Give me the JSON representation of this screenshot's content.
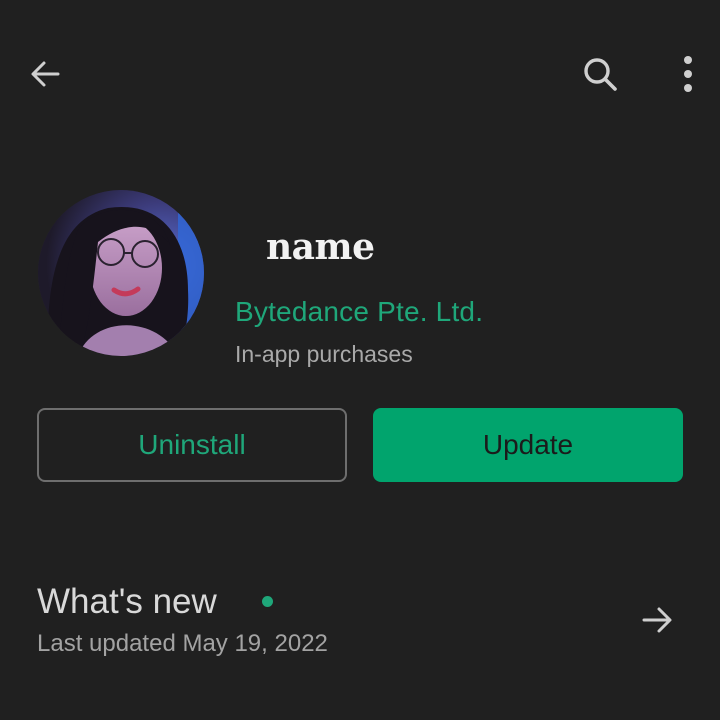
{
  "app": {
    "name": "name",
    "developer": "Bytedance Pte. Ltd.",
    "purchases_note": "In-app purchases"
  },
  "actions": {
    "uninstall_label": "Uninstall",
    "update_label": "Update"
  },
  "whats_new": {
    "title": "What's new",
    "last_updated": "Last updated May 19, 2022"
  },
  "icons": {
    "back": "arrow-back-icon",
    "search": "search-icon",
    "more": "more-vert-icon",
    "forward": "arrow-forward-icon"
  },
  "colors": {
    "background": "#202020",
    "accent": "#01a46d",
    "accent_text": "#1fa77a",
    "secondary_text": "#a9a9a9"
  }
}
